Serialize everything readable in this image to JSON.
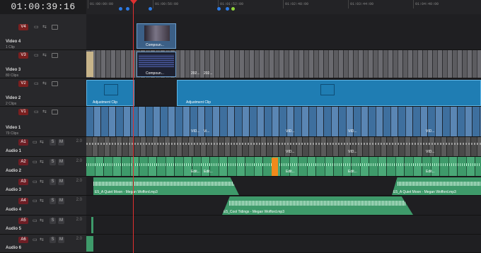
{
  "timecode": "01:00:39:16",
  "ruler": {
    "labels": [
      "01:00:00:00",
      "01:00:56:00",
      "01:01:52:00",
      "01:02:48:00",
      "01:03:44:00",
      "01:04:40:00"
    ]
  },
  "colors": {
    "video_clip": "#3e6f9e",
    "adjustment": "#1f7db3",
    "audio_clip": "#3e9a6a",
    "audio_gray": "#4a4a4a",
    "marker_blue": "#2c7be5",
    "marker_green": "#8fd43a",
    "playhead": "#e03030",
    "orange": "#f08a1c"
  },
  "tracks": {
    "v4": {
      "badge": "V4",
      "name": "Video 4",
      "sub": "1 Clip"
    },
    "v3": {
      "badge": "V3",
      "name": "Video 3",
      "sub": "80 Clips"
    },
    "v2": {
      "badge": "V2",
      "name": "Video 2",
      "sub": "2 Clips"
    },
    "v1": {
      "badge": "V1",
      "name": "Video 1",
      "sub": "79 Clips"
    },
    "a1": {
      "badge": "A1",
      "name": "Audio 1",
      "vol": "2.0"
    },
    "a2": {
      "badge": "A2",
      "name": "Audio 2",
      "vol": "2.0"
    },
    "a3": {
      "badge": "A3",
      "name": "Audio 3",
      "vol": "2.0"
    },
    "a4": {
      "badge": "A4",
      "name": "Audio 4",
      "vol": "2.0"
    },
    "a5": {
      "badge": "A5",
      "name": "Audio 5",
      "vol": "2.0"
    },
    "a6": {
      "badge": "A6",
      "name": "Audio 6",
      "vol": "2.0"
    }
  },
  "clips": {
    "compound_v4": "Compoun...",
    "compound_v3": "Compoun...",
    "v3_a": "202...",
    "v3_b": "202...",
    "adj1": "Adjustment Clip",
    "adj2": "Adjustment Clip",
    "v1_a": "VID...",
    "v1_b": "Vi...",
    "v1_c": "VID...",
    "v1_d": "VID...",
    "v1_e": "VID...",
    "a1_a": "VID...",
    "a1_b": "VID...",
    "a1_c": "VID...",
    "a2_a": "Edit...",
    "a2_b": "Edit...",
    "a2_c": "Edit...",
    "a2_d": "Edit...",
    "a2_e": "Edit...",
    "a3_left": "E5_A Quiet Moon - Megan Wofford.mp3",
    "a3_right": "E5_A Quiet Moon - Megan Wofford.mp3",
    "a4": "E5_Cool Tidings - Megan Wofford.mp3"
  },
  "controls": {
    "solo": "S",
    "mute": "M"
  }
}
